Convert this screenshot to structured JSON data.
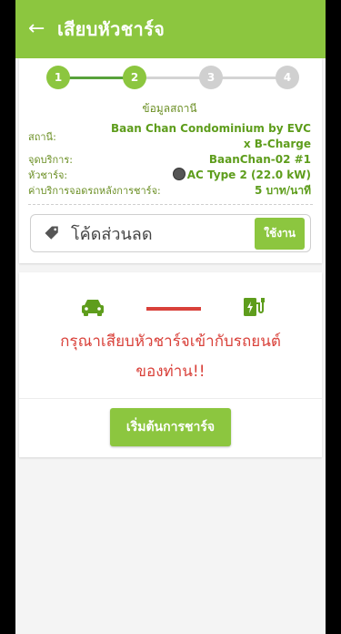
{
  "header": {
    "back_icon": "arrow-left-icon",
    "title": "เสียบหัวชาร์จ"
  },
  "stepper": {
    "steps": [
      {
        "label": "1",
        "state": "done"
      },
      {
        "label": "2",
        "state": "active"
      },
      {
        "label": "3",
        "state": "inactive"
      },
      {
        "label": "4",
        "state": "inactive"
      }
    ]
  },
  "station": {
    "section_title": "ข้อมูลสถานี",
    "station_label": "สถานี:",
    "station_value_line1": "Baan Chan Condominium by EVC",
    "station_value_line2": "x B-Charge",
    "service_point_label": "จุดบริการ:",
    "service_point_value": "BaanChan-02 #1",
    "connector_label": "หัวชาร์จ:",
    "connector_value": "AC Type 2 (22.0 kW)",
    "parking_fee_label": "ค่าบริการจอดรถหลังการชาร์จ:",
    "parking_fee_value": "5 บาท/นาที"
  },
  "coupon": {
    "placeholder": "โค้ดส่วนลด",
    "apply_label": "ใช้งาน"
  },
  "plug": {
    "message_line1": "กรุณาเสียบหัวชาร์จเข้ากับรถยนต์",
    "message_line2": "ของท่าน!!"
  },
  "actions": {
    "start_label": "เริ่มต้นการชาร์จ"
  },
  "colors": {
    "accent": "#8cc63f",
    "accent_dark": "#5e9d1c",
    "warning": "#d9413a"
  }
}
